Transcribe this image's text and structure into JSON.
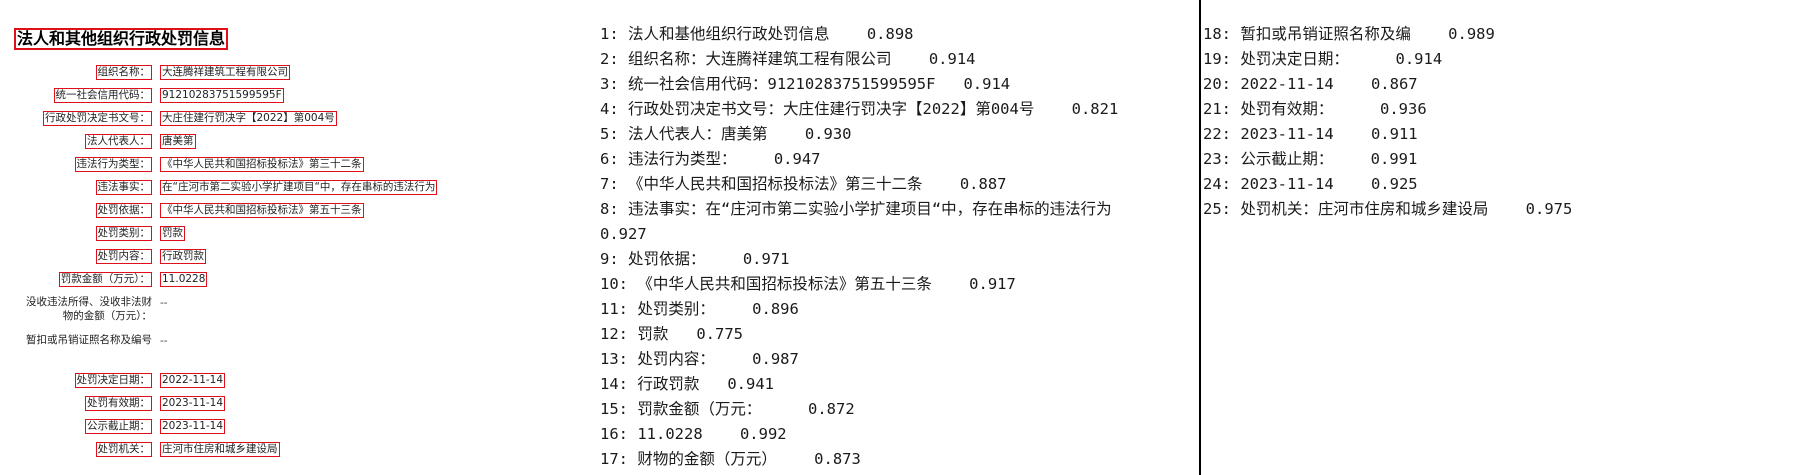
{
  "document": {
    "title": "法人和其他组织行政处罚信息",
    "fields": [
      {
        "label": "组织名称：",
        "value": "大连腾祥建筑工程有限公司"
      },
      {
        "label": "统一社会信用代码：",
        "value": "91210283751599595F"
      },
      {
        "label": "行政处罚决定书文号：",
        "value": "大庄住建行罚决字【2022】第004号"
      },
      {
        "label": "法人代表人：",
        "value": "唐美第"
      },
      {
        "label": "违法行为类型：",
        "value": "《中华人民共和国招标投标法》第三十二条"
      },
      {
        "label": "违法事实：",
        "value": "在“庄河市第二实验小学扩建项目“中，存在串标的违法行为"
      },
      {
        "label": "处罚依据：",
        "value": "《中华人民共和国招标投标法》第五十三条"
      },
      {
        "label": "处罚类别：",
        "value": "罚款"
      },
      {
        "label": "处罚内容：",
        "value": "行政罚款"
      },
      {
        "label": "罚款金额（万元）：",
        "value": "11.0228"
      },
      {
        "label": "没收违法所得、没收非法财物的金额（万元）：",
        "value": "--"
      },
      {
        "label": "暂扣或吊销证照名称及编号",
        "value": "--"
      },
      {
        "label": "处罚决定日期：",
        "value": "2022-11-14"
      },
      {
        "label": "处罚有效期：",
        "value": "2023-11-14"
      },
      {
        "label": "公示截止期：",
        "value": "2023-11-14"
      },
      {
        "label": "处罚机关：",
        "value": "庄河市住房和城乡建设局"
      }
    ]
  },
  "ocr_results": {
    "left_column": [
      "1: 法人和基他组织行政处罚信息    0.898",
      "2: 组织名称：大连腾祥建筑工程有限公司    0.914",
      "3: 统一社会信用代码：91210283751599595F   0.914",
      "4: 行政处罚决定书文号：大庄住建行罚决字【2022】第004号    0.821",
      "5: 法人代表人：唐美第    0.930",
      "6: 违法行为类型：    0.947",
      "7: 《中华人民共和国招标投标法》第三十二条    0.887",
      "8: 违法事实：在“庄河市第二实验小学扩建项目“中，存在串标的违法行为  0.927",
      "9: 处罚依据：    0.971",
      "10: 《中华人民共和国招标投标法》第五十三条    0.917",
      "11: 处罚类别：    0.896",
      "12: 罚款   0.775",
      "13: 处罚内容：    0.987",
      "14: 行政罚款   0.941",
      "15: 罚款金额（万元：     0.872",
      "16: 11.0228    0.992",
      "17: 财物的金额（万元）    0.873"
    ],
    "right_column": [
      "18: 暂扣或吊销证照名称及编    0.989",
      "19: 处罚决定日期：     0.914",
      "20: 2022-11-14    0.867",
      "21: 处罚有效期：     0.936",
      "22: 2023-11-14    0.911",
      "23: 公示截止期：    0.991",
      "24: 2023-11-14    0.925",
      "25: 处罚机关：庄河市住房和城乡建设局    0.975"
    ]
  }
}
